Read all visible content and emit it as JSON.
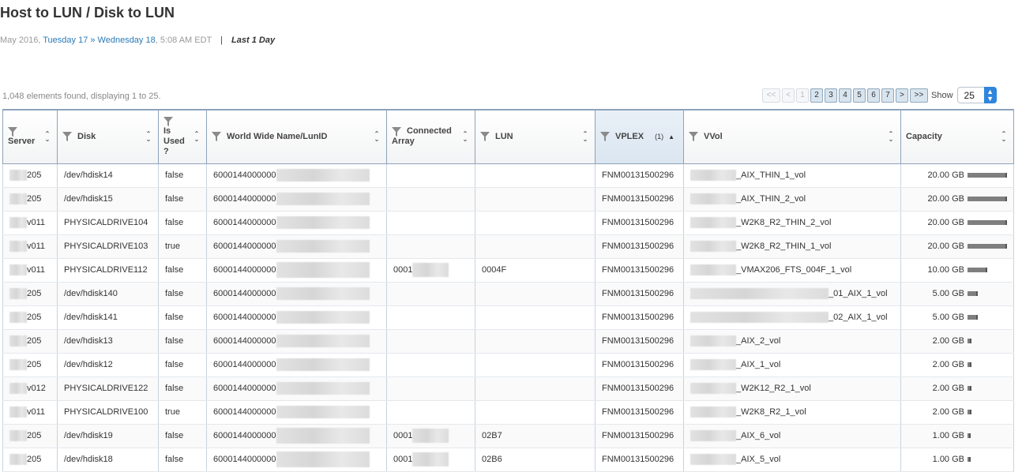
{
  "header": {
    "title": "Host to LUN / Disk to LUN",
    "date_prefix": "May 2016,",
    "date_link": "Tuesday 17 » Wednesday 18",
    "date_time": ", 5:08 AM EDT",
    "separator": "|",
    "range_label": "Last 1 Day"
  },
  "results": {
    "summary": "1,048 elements found, displaying 1 to 25."
  },
  "pagination": {
    "first": "<<",
    "prev": "<",
    "pages": [
      "1",
      "2",
      "3",
      "4",
      "5",
      "6",
      "7"
    ],
    "current_page": "1",
    "next": ">",
    "last": ">>",
    "show_label": "Show",
    "page_size": "25"
  },
  "table": {
    "columns": {
      "server": "Server",
      "disk": "Disk",
      "is_used_1": "Is",
      "is_used_2": "Used",
      "is_used_3": "?",
      "wwn": "World Wide Name/LunID",
      "connected_1": "Connected",
      "connected_2": "Array",
      "lun": "LUN",
      "vplex": "VPLEX",
      "vplex_badge": "(1)",
      "vvol": "VVol",
      "capacity": "Capacity"
    },
    "rows": [
      {
        "server": "205",
        "disk": "/dev/hdisk14",
        "used": "false",
        "wwn": "6000144000000",
        "array": "",
        "lun": "",
        "vplex": "FNM00131500296",
        "vvol": "_AIX_THIN_1_vol",
        "capacity": "20.00 GB",
        "cap_fraction": 1.0
      },
      {
        "server": "205",
        "disk": "/dev/hdisk15",
        "used": "false",
        "wwn": "6000144000000",
        "array": "",
        "lun": "",
        "vplex": "FNM00131500296",
        "vvol": "_AIX_THIN_2_vol",
        "capacity": "20.00 GB",
        "cap_fraction": 1.0
      },
      {
        "server": "v011",
        "disk": "PHYSICALDRIVE104",
        "used": "false",
        "wwn": "6000144000000",
        "array": "",
        "lun": "",
        "vplex": "FNM00131500296",
        "vvol": "_W2K8_R2_THIN_2_vol",
        "capacity": "20.00 GB",
        "cap_fraction": 1.0
      },
      {
        "server": "v011",
        "disk": "PHYSICALDRIVE103",
        "used": "true",
        "wwn": "6000144000000",
        "array": "",
        "lun": "",
        "vplex": "FNM00131500296",
        "vvol": "_W2K8_R2_THIN_1_vol",
        "capacity": "20.00 GB",
        "cap_fraction": 1.0
      },
      {
        "server": "v011",
        "disk": "PHYSICALDRIVE112",
        "used": "false",
        "wwn": "6000144000000",
        "array": "0001",
        "lun": "0004F",
        "vplex": "FNM00131500296",
        "vvol": "_VMAX206_FTS_004F_1_vol",
        "capacity": "10.00 GB",
        "cap_fraction": 0.5
      },
      {
        "server": "205",
        "disk": "/dev/hdisk140",
        "used": "false",
        "wwn": "6000144000000",
        "array": "",
        "lun": "",
        "vplex": "FNM00131500296",
        "vvol": "_01_AIX_1_vol",
        "capacity": "5.00 GB",
        "cap_fraction": 0.25
      },
      {
        "server": "205",
        "disk": "/dev/hdisk141",
        "used": "false",
        "wwn": "6000144000000",
        "array": "",
        "lun": "",
        "vplex": "FNM00131500296",
        "vvol": "_02_AIX_1_vol",
        "capacity": "5.00 GB",
        "cap_fraction": 0.25
      },
      {
        "server": "205",
        "disk": "/dev/hdisk13",
        "used": "false",
        "wwn": "6000144000000",
        "array": "",
        "lun": "",
        "vplex": "FNM00131500296",
        "vvol": "_AIX_2_vol",
        "capacity": "2.00 GB",
        "cap_fraction": 0.1
      },
      {
        "server": "205",
        "disk": "/dev/hdisk12",
        "used": "false",
        "wwn": "6000144000000",
        "array": "",
        "lun": "",
        "vplex": "FNM00131500296",
        "vvol": "_AIX_1_vol",
        "capacity": "2.00 GB",
        "cap_fraction": 0.1
      },
      {
        "server": "v012",
        "disk": "PHYSICALDRIVE122",
        "used": "false",
        "wwn": "6000144000000",
        "array": "",
        "lun": "",
        "vplex": "FNM00131500296",
        "vvol": "_W2K12_R2_1_vol",
        "capacity": "2.00 GB",
        "cap_fraction": 0.1
      },
      {
        "server": "v011",
        "disk": "PHYSICALDRIVE100",
        "used": "true",
        "wwn": "6000144000000",
        "array": "",
        "lun": "",
        "vplex": "FNM00131500296",
        "vvol": "_W2K8_R2_1_vol",
        "capacity": "2.00 GB",
        "cap_fraction": 0.1
      },
      {
        "server": "205",
        "disk": "/dev/hdisk19",
        "used": "false",
        "wwn": "6000144000000",
        "array": "0001",
        "lun": "02B7",
        "vplex": "FNM00131500296",
        "vvol": "_AIX_6_vol",
        "capacity": "1.00 GB",
        "cap_fraction": 0.05
      },
      {
        "server": "205",
        "disk": "/dev/hdisk18",
        "used": "false",
        "wwn": "6000144000000",
        "array": "0001",
        "lun": "02B6",
        "vplex": "FNM00131500296",
        "vvol": "_AIX_5_vol",
        "capacity": "1.00 GB",
        "cap_fraction": 0.05
      }
    ]
  },
  "colors": {
    "link": "#2a7ab7",
    "header_border": "#8da3bb",
    "sorted_header": "#dbe6f1",
    "select_arrow": "#2f86dc",
    "capacity_bar": "#7f7f7f"
  }
}
